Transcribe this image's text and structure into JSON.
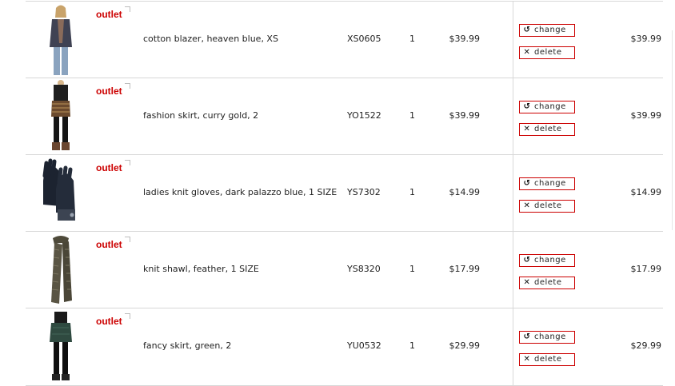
{
  "badge": "outlet",
  "buttons": {
    "change": "change",
    "delete": "delete"
  },
  "items": [
    {
      "description": "cotton blazer, heaven blue, XS",
      "sku": "XS0605",
      "qty": "1",
      "price": "$39.99",
      "total": "$39.99"
    },
    {
      "description": "fashion skirt, curry gold, 2",
      "sku": "YO1522",
      "qty": "1",
      "price": "$39.99",
      "total": "$39.99"
    },
    {
      "description": "ladies knit gloves, dark palazzo blue, 1 SIZE",
      "sku": "YS7302",
      "qty": "1",
      "price": "$14.99",
      "total": "$14.99"
    },
    {
      "description": "knit shawl, feather, 1 SIZE",
      "sku": "YS8320",
      "qty": "1",
      "price": "$17.99",
      "total": "$17.99"
    },
    {
      "description": "fancy skirt, green, 2",
      "sku": "YU0532",
      "qty": "1",
      "price": "$29.99",
      "total": "$29.99"
    }
  ]
}
